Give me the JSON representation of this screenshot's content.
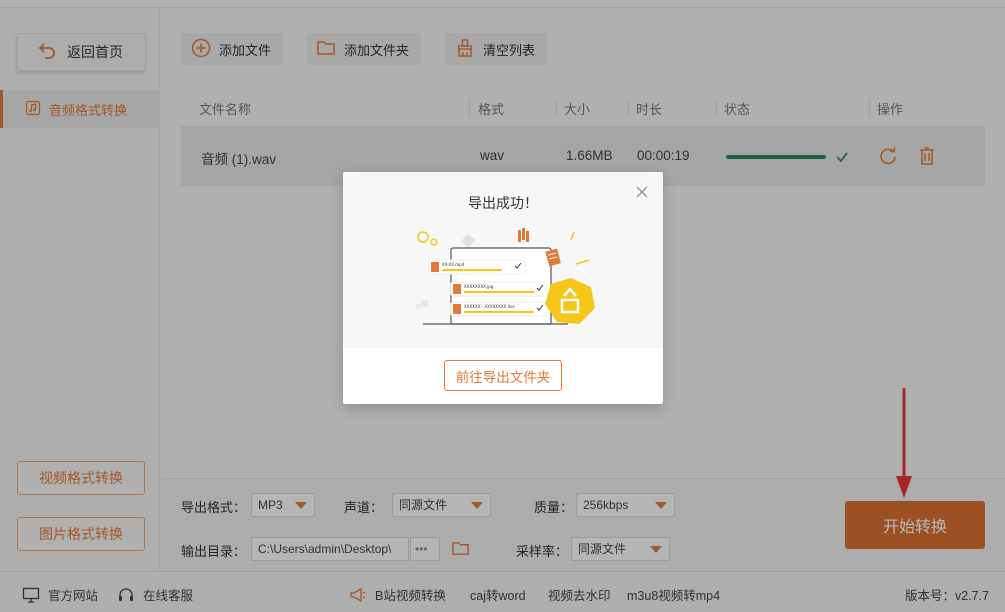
{
  "sidebar": {
    "back_label": "返回首页",
    "active_item": "音频格式转换",
    "video_btn": "视频格式转换",
    "image_btn": "图片格式转换"
  },
  "toolbar": {
    "add_file": "添加文件",
    "add_folder": "添加文件夹",
    "clear_list": "清空列表"
  },
  "table": {
    "headers": [
      "文件名称",
      "格式",
      "大小",
      "时长",
      "状态",
      "操作"
    ],
    "rows": [
      {
        "name": "音频 (1).wav",
        "format": "wav",
        "size": "1.66MB",
        "duration": "00:00:19",
        "progress": 1.0
      }
    ]
  },
  "settings": {
    "format_label": "导出格式：",
    "format_value": "MP3",
    "channel_label": "声道：",
    "channel_value": "同源文件",
    "quality_label": "质量：",
    "quality_value": "256kbps",
    "output_label": "输出目录：",
    "output_value": "C:\\Users\\admin\\Desktop\\",
    "output_more": "•••",
    "samplerate_label": "采样率：",
    "samplerate_value": "同源文件",
    "start_btn": "开始转换"
  },
  "statusbar": {
    "website": "官方网站",
    "support": "在线客服",
    "links": [
      "B站视频转换",
      "caj转word",
      "视频去水印",
      "m3u8视频转mp4"
    ],
    "version": "版本号：v2.7.7"
  },
  "modal": {
    "title": "导出成功！",
    "button": "前往导出文件夹",
    "illus_files": [
      "XX-XX.mp4",
      "XXXXXXXX.jpg",
      "XXXXXX - XXXXXXXX.doc"
    ]
  },
  "colors": {
    "accent": "#e07a37",
    "start_button": "#d86f33",
    "progress": "#2a8a5a",
    "illus_yellow": "#f5c518"
  }
}
